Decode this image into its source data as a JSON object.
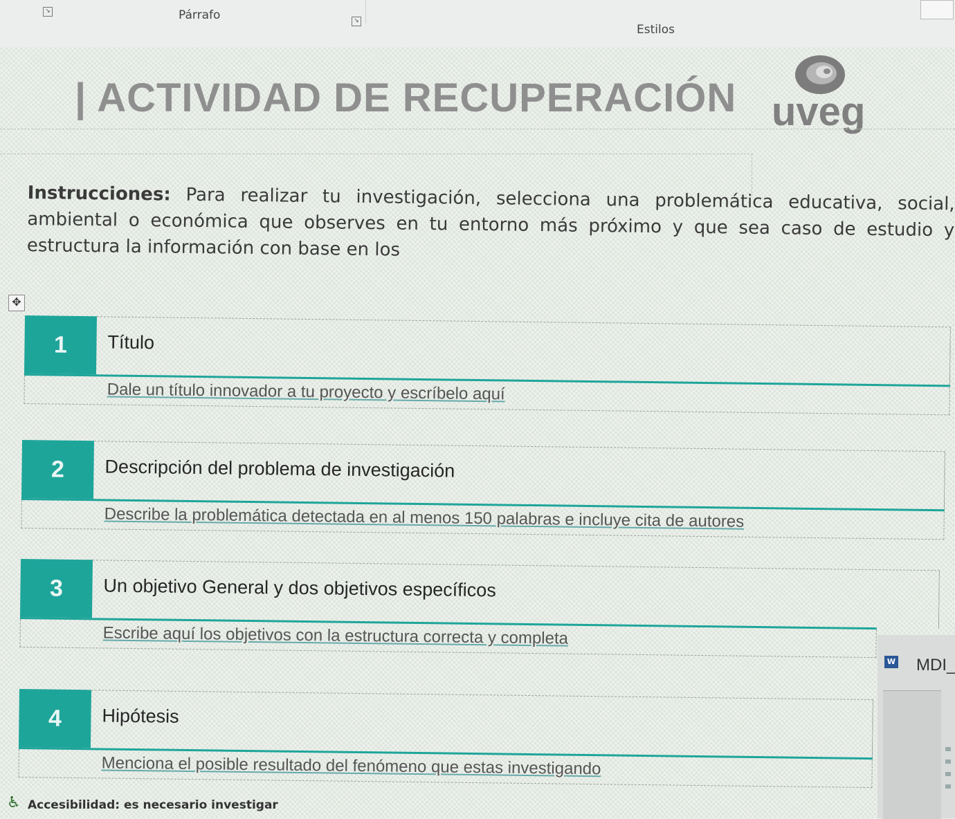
{
  "ribbon": {
    "paragraph_label": "Párrafo",
    "styles_label": "Estilos"
  },
  "document": {
    "title": "| ACTIVIDAD DE RECUPERACIÓN",
    "logo_text": "uveg",
    "instructions_bold": "Instrucciones:",
    "instructions_text": "Para realizar tu investigación, selecciona una problemática educativa, social, ambiental o económica que observes en tu entorno más próximo y que sea caso de estudio y estructura la información con base en los",
    "sections": [
      {
        "number": "1",
        "title": "Título",
        "desc": "Dale un título innovador a tu proyecto y escríbelo aquí"
      },
      {
        "number": "2",
        "title": "Descripción del problema de investigación",
        "desc": "Describe la problemática detectada en al menos 150 palabras e incluye cita de autores"
      },
      {
        "number": "3",
        "title": "Un objetivo General y dos objetivos específicos",
        "desc": "Escribe aquí los objetivos con la estructura correcta y completa"
      },
      {
        "number": "4",
        "title": "Hipótesis",
        "desc": "Menciona el posible resultado del fenómeno que estas investigando"
      }
    ]
  },
  "taskbar": {
    "app_label": "MDI_",
    "icon": "word-icon"
  },
  "status": {
    "accessibility_label": "Accesibilidad:",
    "accessibility_value": "es necesario investigar"
  },
  "colors": {
    "accent": "#1ea59a",
    "title_gray": "#8f8f8f"
  }
}
